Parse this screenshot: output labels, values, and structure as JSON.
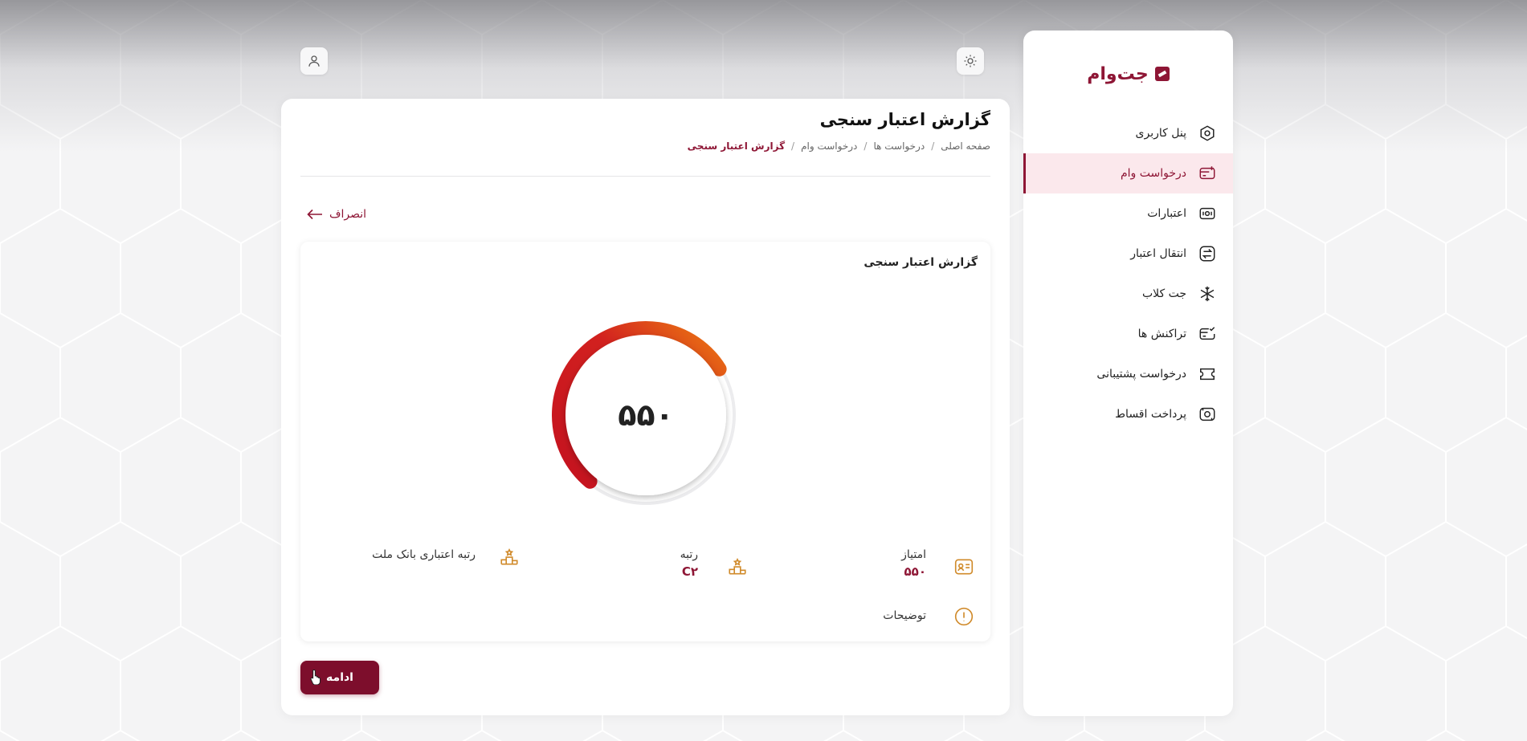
{
  "brand": {
    "name": "جت‌وام",
    "accent": "#8e1635"
  },
  "header": {
    "user_icon": "user-icon",
    "theme_icon": "sun-icon"
  },
  "sidebar": {
    "items": [
      {
        "label": "پنل کاربری",
        "icon": "gear-hexagon-icon",
        "active": false
      },
      {
        "label": "درخواست وام",
        "icon": "card-add-icon",
        "active": true
      },
      {
        "label": "اعتبارات",
        "icon": "cash-icon",
        "active": false
      },
      {
        "label": "انتقال اعتبار",
        "icon": "transfer-icon",
        "active": false
      },
      {
        "label": "جت کلاب",
        "icon": "snowflake-icon",
        "active": false
      },
      {
        "label": "تراکنش ها",
        "icon": "card-check-icon",
        "active": false
      },
      {
        "label": "درخواست پشتیبانی",
        "icon": "ticket-icon",
        "active": false
      },
      {
        "label": "پرداخت اقساط",
        "icon": "installment-icon",
        "active": false
      }
    ]
  },
  "page": {
    "title": "گزارش اعتبار سنجی",
    "breadcrumb": [
      "صفحه اصلی",
      "درخواست ها",
      "درخواست وام",
      "گزارش اعتبار سنجی"
    ],
    "cancel_label": "انصراف",
    "continue_label": "ادامه"
  },
  "report": {
    "title": "گزارش اعتبار سنجی",
    "score_display": "۵۵۰",
    "score_fraction": 0.55,
    "stats": {
      "score_label": "امتیاز",
      "score_value": "۵۵۰",
      "rank_label": "رتبه",
      "rank_value": "C۲",
      "bank_rank_label": "رتبه اعتباری بانک ملت"
    },
    "description_label": "توضیحات"
  }
}
